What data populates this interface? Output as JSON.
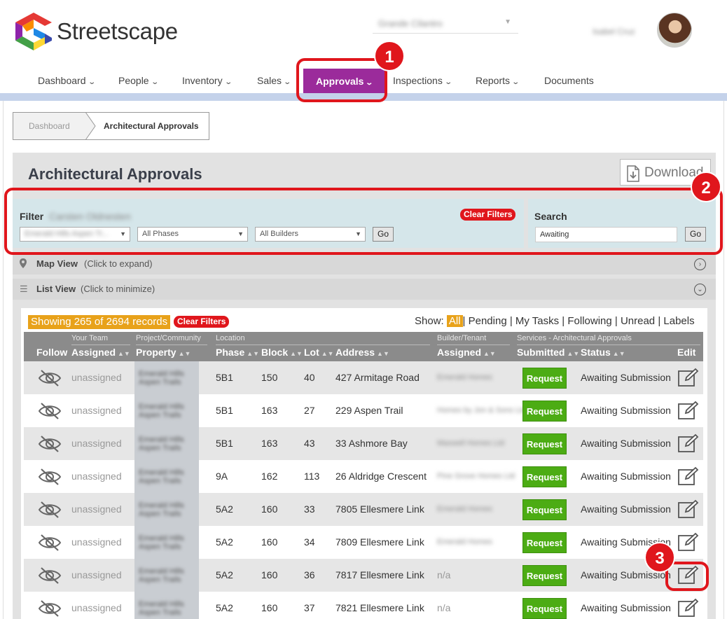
{
  "app": {
    "brand": "Streetscape"
  },
  "header": {
    "community_select": "Grande Cilantro",
    "user_name": "Isabel Cruz"
  },
  "nav": {
    "items": [
      {
        "label": "Dashboard"
      },
      {
        "label": "People"
      },
      {
        "label": "Inventory"
      },
      {
        "label": "Sales"
      },
      {
        "label": "Approvals"
      },
      {
        "label": "Inspections"
      },
      {
        "label": "Reports"
      },
      {
        "label": "Documents"
      }
    ]
  },
  "breadcrumb": {
    "home": "Dashboard",
    "current": "Architectural Approvals"
  },
  "page": {
    "title": "Architectural Approvals",
    "download_label": "Download"
  },
  "filter": {
    "label": "Filter",
    "community_name": "Carsten Oldnesten",
    "project_value": "Emerald Hills Aspen Tr...",
    "phases_value": "All Phases",
    "builders_value": "All Builders",
    "go_label": "Go",
    "clear_label": "Clear Filters"
  },
  "search": {
    "label": "Search",
    "value": "Awaiting",
    "go_label": "Go"
  },
  "map_view": {
    "title": "Map View",
    "hint": "(Click to expand)"
  },
  "list_view": {
    "title": "List View",
    "hint": "(Click to minimize)"
  },
  "records": {
    "summary": "Showing 265 of 2694 records",
    "clear_label": "Clear Filters"
  },
  "show": {
    "label": "Show:",
    "all": "All",
    "options": "| Pending | My Tasks | Following | Unread | Labels"
  },
  "table": {
    "groups": {
      "your_team": "Your Team",
      "project": "Project/Community",
      "location": "Location",
      "builder": "Builder/Tenant",
      "services": "Services - Architectural Approvals"
    },
    "columns": {
      "follow": "Follow",
      "assigned": "Assigned",
      "property": "Property",
      "phase": "Phase",
      "block": "Block",
      "lot": "Lot",
      "address": "Address",
      "builder_assigned": "Assigned",
      "submitted": "Submitted",
      "status": "Status",
      "edit": "Edit"
    },
    "rows": [
      {
        "assigned": "unassigned",
        "property": "Emerald Hills Aspen Trails",
        "phase": "5B1",
        "block": "150",
        "lot": "40",
        "address": "427 Armitage Road",
        "builder": "Emerald Homes",
        "builder_blurred": true,
        "submitted": "Request",
        "status": "Awaiting Submission"
      },
      {
        "assigned": "unassigned",
        "property": "Emerald Hills Aspen Trails",
        "phase": "5B1",
        "block": "163",
        "lot": "27",
        "address": "229 Aspen Trail",
        "builder": "Homes by Jon & Sons Ltd",
        "builder_blurred": true,
        "submitted": "Request",
        "status": "Awaiting Submission"
      },
      {
        "assigned": "unassigned",
        "property": "Emerald Hills Aspen Trails",
        "phase": "5B1",
        "block": "163",
        "lot": "43",
        "address": "33 Ashmore Bay",
        "builder": "Maxwell Homes Ltd",
        "builder_blurred": true,
        "submitted": "Request",
        "status": "Awaiting Submission"
      },
      {
        "assigned": "unassigned",
        "property": "Emerald Hills Aspen Trails",
        "phase": "9A",
        "block": "162",
        "lot": "113",
        "address": "26 Aldridge Crescent",
        "builder": "Pine Grove Homes Ltd",
        "builder_blurred": true,
        "submitted": "Request",
        "status": "Awaiting Submission"
      },
      {
        "assigned": "unassigned",
        "property": "Emerald Hills Aspen Trails",
        "phase": "5A2",
        "block": "160",
        "lot": "33",
        "address": "7805 Ellesmere Link",
        "builder": "Emerald Homes",
        "builder_blurred": true,
        "submitted": "Request",
        "status": "Awaiting Submission"
      },
      {
        "assigned": "unassigned",
        "property": "Emerald Hills Aspen Trails",
        "phase": "5A2",
        "block": "160",
        "lot": "34",
        "address": "7809 Ellesmere Link",
        "builder": "Emerald Homes",
        "builder_blurred": true,
        "submitted": "Request",
        "status": "Awaiting Submission"
      },
      {
        "assigned": "unassigned",
        "property": "Emerald Hills Aspen Trails",
        "phase": "5A2",
        "block": "160",
        "lot": "36",
        "address": "7817 Ellesmere Link",
        "builder": "n/a",
        "builder_blurred": false,
        "submitted": "Request",
        "status": "Awaiting Submission"
      },
      {
        "assigned": "unassigned",
        "property": "Emerald Hills Aspen Trails",
        "phase": "5A2",
        "block": "160",
        "lot": "37",
        "address": "7821 Ellesmere Link",
        "builder": "n/a",
        "builder_blurred": false,
        "submitted": "Request",
        "status": "Awaiting Submission"
      }
    ]
  },
  "callouts": [
    "1",
    "2",
    "3"
  ],
  "colors": {
    "accent_purple": "#9b2b9b",
    "callout_red": "#e0161c",
    "request_green": "#4cac14",
    "records_orange": "#e8a21a",
    "filter_bg": "#d5e6ea"
  },
  "icons": [
    "eye-slash-icon",
    "edit-icon",
    "download-icon",
    "map-pin-icon",
    "list-icon",
    "chevron-down-icon"
  ]
}
